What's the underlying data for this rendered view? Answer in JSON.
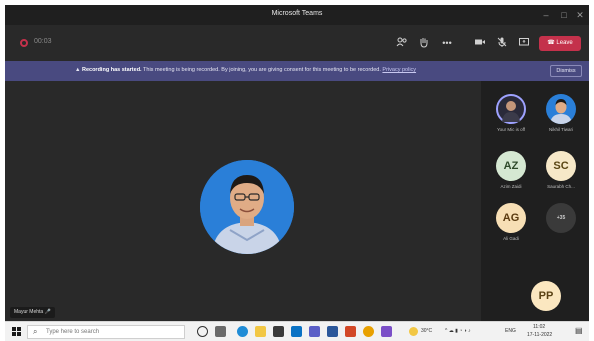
{
  "window": {
    "title": "Microsoft Teams"
  },
  "toolbar": {
    "timer": "00:03",
    "leave_label": "Leave"
  },
  "banner": {
    "bold": "Recording has started.",
    "text": " This meeting is being recorded. By joining, you are giving consent for this meeting to be recorded.",
    "link": "Privacy policy",
    "dismiss_label": "Dismiss"
  },
  "stage": {
    "presenter_name": "Mayur Mehta"
  },
  "gallery": [
    {
      "initials": "",
      "name": "Your Mic is off",
      "style": "photo"
    },
    {
      "initials": "",
      "name": "Nikhil Tiwari",
      "style": "photo"
    },
    {
      "initials": "AZ",
      "name": "Azim Zaidi",
      "style": "az"
    },
    {
      "initials": "SC",
      "name": "Saurabh Ch...",
      "style": "sc"
    },
    {
      "initials": "AG",
      "name": "Ali Gadi",
      "style": "ag"
    },
    {
      "initials": "+35",
      "name": "",
      "style": "unk"
    },
    {
      "initials": "PP",
      "name": "",
      "style": "pp"
    }
  ],
  "taskbar": {
    "search_placeholder": "Type here to search",
    "weather": "30°C",
    "lang": "ENG",
    "time": "11:02",
    "date": "17-11-2022"
  }
}
